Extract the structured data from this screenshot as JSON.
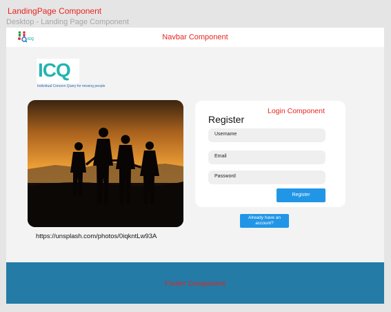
{
  "frame": {
    "component_label": "LandingPage Component",
    "design_label": "Desktop - Landing Page Component"
  },
  "navbar": {
    "title": "Navbar Component",
    "logo_icon": "people-logo-icon",
    "logo_text": "ICQ"
  },
  "brand": {
    "logo_text": "ICQ",
    "tagline": "Individual Concern Query for missing people"
  },
  "hero": {
    "image_description_icon": "family-silhouette-sunset-image",
    "photo_credit": "https://unsplash.com/photos/0iqkntLw93A"
  },
  "login": {
    "component_label": "Login Component",
    "title": "Register",
    "username_placeholder": "Username",
    "email_placeholder": "Email",
    "password_placeholder": "Password",
    "register_label": "Register"
  },
  "already_account": {
    "label": "Already have an account?"
  },
  "footer": {
    "label": "Footer Component"
  },
  "colors": {
    "accent_red": "#e8231f",
    "button_blue": "#2196e6",
    "footer_blue": "#237ba6",
    "brand_teal": "#22b5b0"
  }
}
